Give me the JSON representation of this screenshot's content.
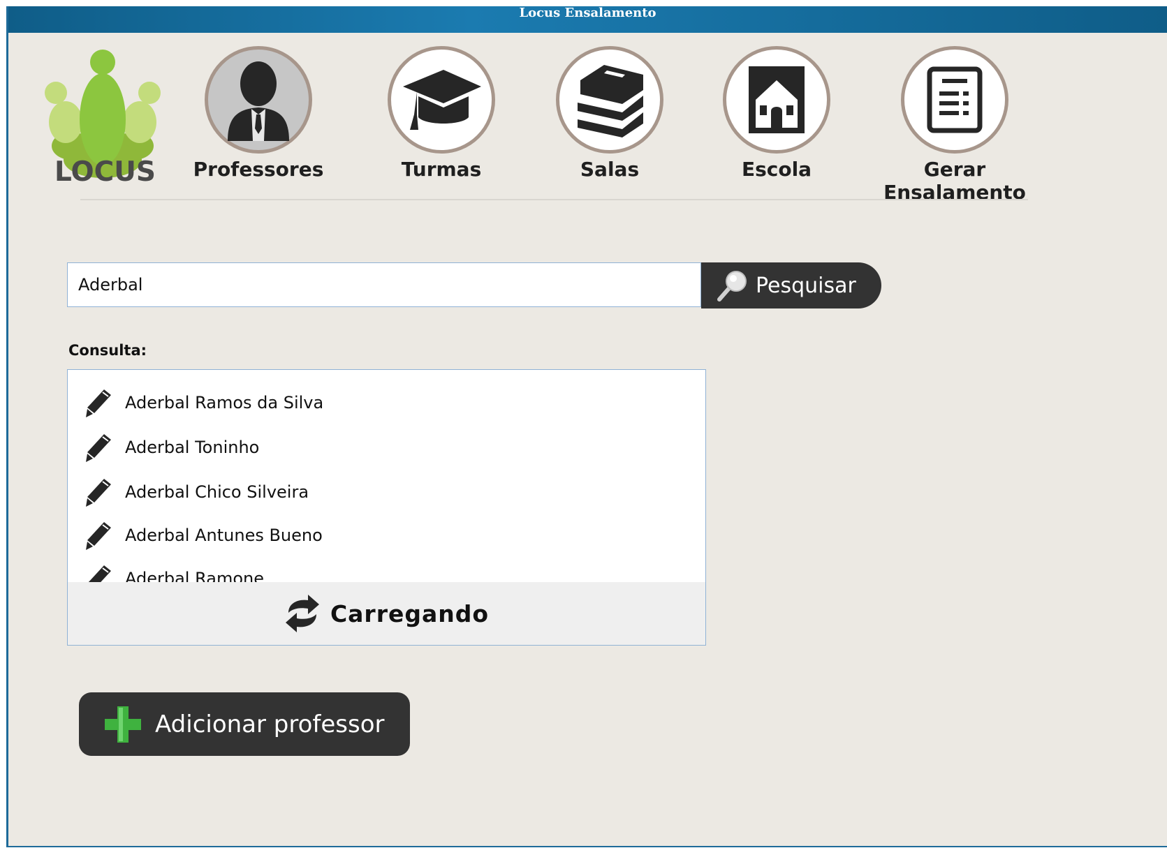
{
  "window": {
    "title": "Locus Ensalamento"
  },
  "logo": {
    "text": "LOCUS"
  },
  "nav": [
    {
      "label": "Professores",
      "icon": "teacher-icon",
      "active": true
    },
    {
      "label": "Turmas",
      "icon": "graduation-cap-icon",
      "active": false
    },
    {
      "label": "Salas",
      "icon": "books-icon",
      "active": false
    },
    {
      "label": "Escola",
      "icon": "school-icon",
      "active": false
    },
    {
      "label": "Gerar Ensalamento",
      "icon": "report-icon",
      "active": false
    }
  ],
  "search": {
    "value": "Aderbal",
    "button_label": "Pesquisar"
  },
  "consulta": {
    "label": "Consulta:",
    "results": [
      "Aderbal Ramos da Silva",
      "Aderbal Toninho",
      "Aderbal Chico Silveira",
      "Aderbal Antunes Bueno",
      "Aderbal Ramone"
    ],
    "loading_label": "Carregando"
  },
  "add_button": {
    "label": "Adicionar professor"
  },
  "colors": {
    "title_bar": "#146fa0",
    "background": "#ece9e3",
    "button_dark": "#333333",
    "accent_green": "#3fb23f"
  }
}
